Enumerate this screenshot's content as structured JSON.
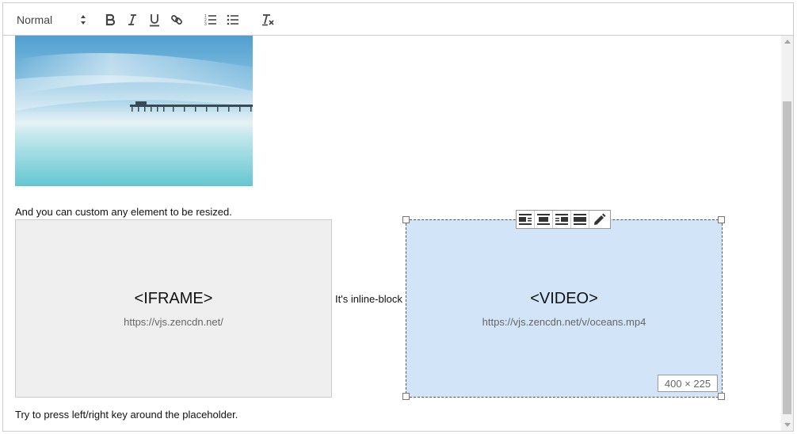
{
  "toolbar": {
    "format_value": "Normal",
    "buttons": [
      "bold",
      "italic",
      "underline",
      "link",
      "ordered-list",
      "bullet-list",
      "clear-formatting"
    ]
  },
  "content": {
    "paragraph_resize": "And you can custom any element to be resized.",
    "iframe": {
      "title": "<IFRAME>",
      "url": "https://vjs.zencdn.net/"
    },
    "inline_text": "It's inline-block",
    "video": {
      "title": "<VIDEO>",
      "url": "https://vjs.zencdn.net/v/oceans.mp4"
    },
    "size_label": "400 × 225",
    "paragraph_keys": "Try to press left/right key around the placeholder."
  },
  "float_toolbar": {
    "buttons": [
      "align-left-icon",
      "align-center-icon",
      "align-right-icon",
      "full-width-icon",
      "edit-icon"
    ]
  },
  "colors": {
    "video_bg": "#d2e4f8",
    "iframe_bg": "#efefef",
    "border": "#cccccc"
  }
}
